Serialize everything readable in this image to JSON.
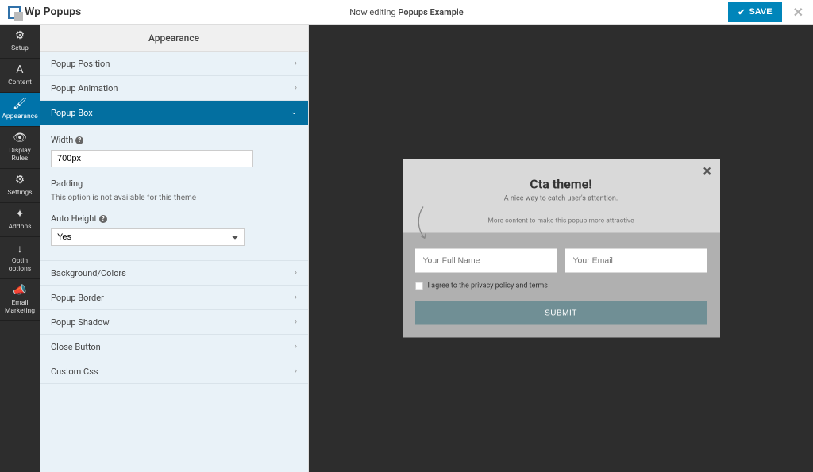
{
  "header": {
    "logo_text": "Wp Popups",
    "editing_prefix": "Now editing",
    "editing_title": "Popups Example",
    "save_label": "SAVE"
  },
  "rail": {
    "items": [
      {
        "label": "Setup",
        "icon": "⚙"
      },
      {
        "label": "Content",
        "icon": "A"
      },
      {
        "label": "Appearance",
        "icon": "🖌"
      },
      {
        "label": "Display Rules",
        "icon": "👁"
      },
      {
        "label": "Settings",
        "icon": "⚙"
      },
      {
        "label": "Addons",
        "icon": "✦"
      },
      {
        "label": "Optin options",
        "icon": "↓"
      },
      {
        "label": "Email Marketing",
        "icon": "📣"
      }
    ],
    "active_index": 2
  },
  "section_title": "Appearance",
  "accordion": {
    "before": [
      {
        "label": "Popup Position"
      },
      {
        "label": "Popup Animation"
      }
    ],
    "active": {
      "label": "Popup Box"
    },
    "after": [
      {
        "label": "Background/Colors"
      },
      {
        "label": "Popup Border"
      },
      {
        "label": "Popup Shadow"
      },
      {
        "label": "Close Button"
      },
      {
        "label": "Custom Css"
      }
    ]
  },
  "box_controls": {
    "width_label": "Width",
    "width_value": "700px",
    "padding_label": "Padding",
    "padding_note": "This option is not available for this theme",
    "auto_height_label": "Auto Height",
    "auto_height_value": "Yes"
  },
  "popup_preview": {
    "title": "Cta theme!",
    "subtitle": "A nice way to catch user's attention.",
    "more": "More content to make this popup more attractive",
    "name_placeholder": "Your Full Name",
    "email_placeholder": "Your Email",
    "terms": "I agree to the privacy policy and terms",
    "submit": "SUBMIT"
  }
}
